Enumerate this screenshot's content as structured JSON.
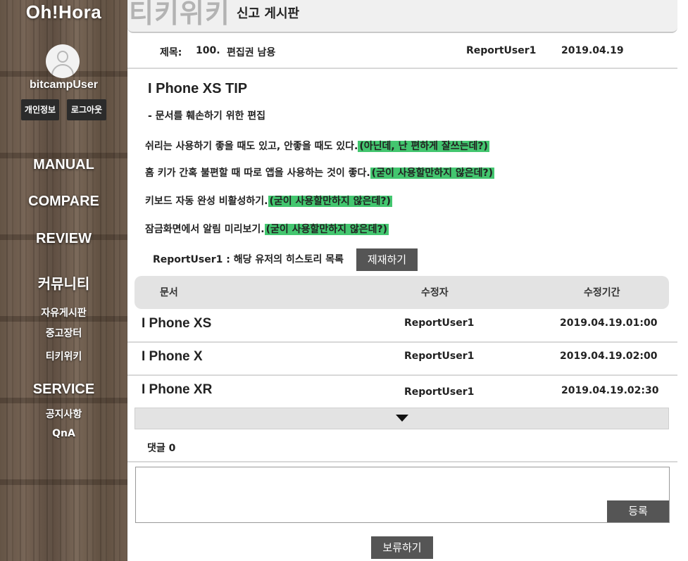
{
  "sidebar": {
    "brand": "Oh!Hora",
    "username": "bitcampUser",
    "profile_label": "개인정보",
    "logout_label": "로그아웃",
    "menu": {
      "manual": "MANUAL",
      "compare": "COMPARE",
      "review": "REVIEW",
      "community": "커뮤니티",
      "community_items": [
        "자유게시판",
        "중고장터",
        "티키위키"
      ],
      "service": "SERVICE",
      "service_items": [
        "공지사항",
        "QnA"
      ]
    }
  },
  "header": {
    "section_title": "티키위키",
    "board_title": "신고 게시판"
  },
  "report": {
    "subject_label": "제목:",
    "number": "100.",
    "subject": "편집권 남용",
    "author": "ReportUser1",
    "date": "2019.04.19"
  },
  "document": {
    "title": "I Phone XS TIP",
    "reason": "- 문서를 훼손하기 위한 편집",
    "lines": [
      {
        "text": "쉬리는 사용하기 좋을 때도 있고, 안좋을 때도 있다.",
        "edit": "(아닌데, 난 편하게 잘쓰는데?)"
      },
      {
        "text": "홈 키가 간혹 불편할 때 따로 앱을 사용하는 것이 좋다.",
        "edit": "(굳이 사용할만하지 않은데?)"
      },
      {
        "text": "키보드 자동 완성 비활성하기.",
        "edit": "(굳이 사용할만하지 않은데?)"
      },
      {
        "text": "잠금화면에서 알림 미리보기.",
        "edit": "(굳이 사용할만하지 않은데?)"
      }
    ]
  },
  "history": {
    "label": "ReportUser1 : 해당 유저의 히스토리 목록",
    "sanction_label": "제재하기",
    "columns": [
      "문서",
      "수정자",
      "수정기간"
    ],
    "rows": [
      {
        "doc": "I Phone XS",
        "editor": "ReportUser1",
        "time": "2019.04.19.01:00"
      },
      {
        "doc": "I Phone X",
        "editor": "ReportUser1",
        "time": "2019.04.19.02:00"
      },
      {
        "doc": "I Phone XR",
        "editor": "ReportUser1",
        "time": "2019.04.19.02:30"
      }
    ]
  },
  "comments": {
    "count_label": "댓글 0",
    "input_value": "",
    "register_label": "등록"
  },
  "footer": {
    "hold_label": "보류하기"
  },
  "colors": {
    "highlight": "#43c66f",
    "button": "#555555",
    "table_header": "#e3e3e3"
  }
}
